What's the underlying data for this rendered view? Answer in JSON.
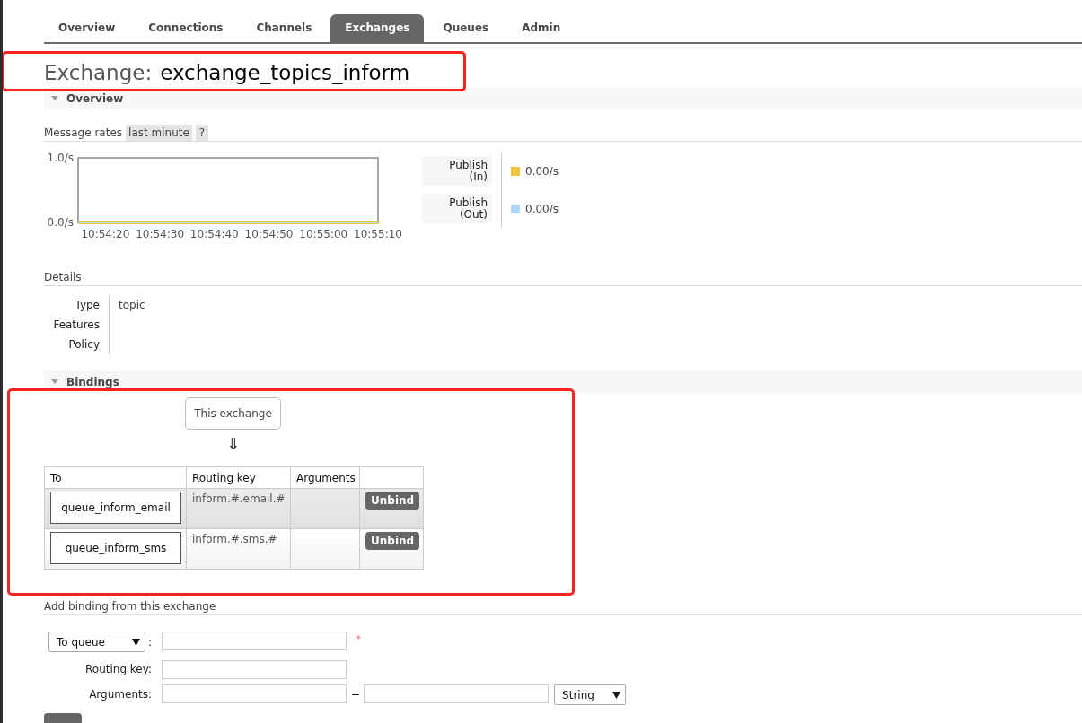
{
  "tabs": [
    {
      "label": "Overview",
      "selected": false
    },
    {
      "label": "Connections",
      "selected": false
    },
    {
      "label": "Channels",
      "selected": false
    },
    {
      "label": "Exchanges",
      "selected": true
    },
    {
      "label": "Queues",
      "selected": false
    },
    {
      "label": "Admin",
      "selected": false
    }
  ],
  "title": {
    "label": "Exchange:",
    "name": "exchange_topics_inform",
    "highlighted": true
  },
  "overview": {
    "heading": "Overview",
    "expanded": true,
    "message_rates": {
      "label": "Message rates",
      "period": "last minute",
      "help": "?",
      "chart_data": {
        "type": "line",
        "categories": [
          null,
          "10:54:20",
          null,
          "10:54:30",
          null,
          "10:54:40",
          null,
          "10:54:50",
          null,
          "10:55:00",
          null,
          "10:55:10"
        ],
        "ylim": [
          0,
          1
        ],
        "yticks": [
          {
            "value": 0,
            "label": "0.0/s"
          },
          {
            "value": 1,
            "label": "1.0/s"
          }
        ],
        "series": [
          {
            "name": "Publish (In)",
            "color": "#edc240",
            "values": [
              0,
              0,
              0,
              0,
              0,
              0,
              0,
              0,
              0,
              0,
              0,
              0
            ]
          },
          {
            "name": "Publish (Out)",
            "color": "#afd8f8",
            "values": [
              0,
              0,
              0,
              0,
              0,
              0,
              0,
              0,
              0,
              0,
              0,
              0
            ]
          }
        ]
      },
      "legend_readings": [
        "0.00/s",
        "0.00/s"
      ]
    },
    "details": {
      "heading": "Details",
      "rows": [
        {
          "label": "Type",
          "value": "topic"
        },
        {
          "label": "Features"
        },
        {
          "label": "Policy"
        }
      ]
    }
  },
  "bindings": {
    "heading": "Bindings",
    "expanded": true,
    "highlighted": true,
    "source": "This exchange",
    "arrow": "⇓",
    "columns": [
      "To",
      "Routing key",
      "Arguments"
    ],
    "rows": [
      {
        "to": "queue_inform_email",
        "routing_key": "inform.#.email.#",
        "action": "Unbind"
      },
      {
        "to": "queue_inform_sms",
        "routing_key": "inform.#.sms.#",
        "action": "Unbind"
      }
    ]
  },
  "add_binding": {
    "heading": "Add binding from this exchange",
    "destination_type": "To queue",
    "separator": ":",
    "required_mark": "*",
    "routing_key_label": "Routing key:",
    "arguments_label": "Arguments:",
    "equals": "=",
    "argument_type": "String",
    "submit_partly_visible": true
  }
}
